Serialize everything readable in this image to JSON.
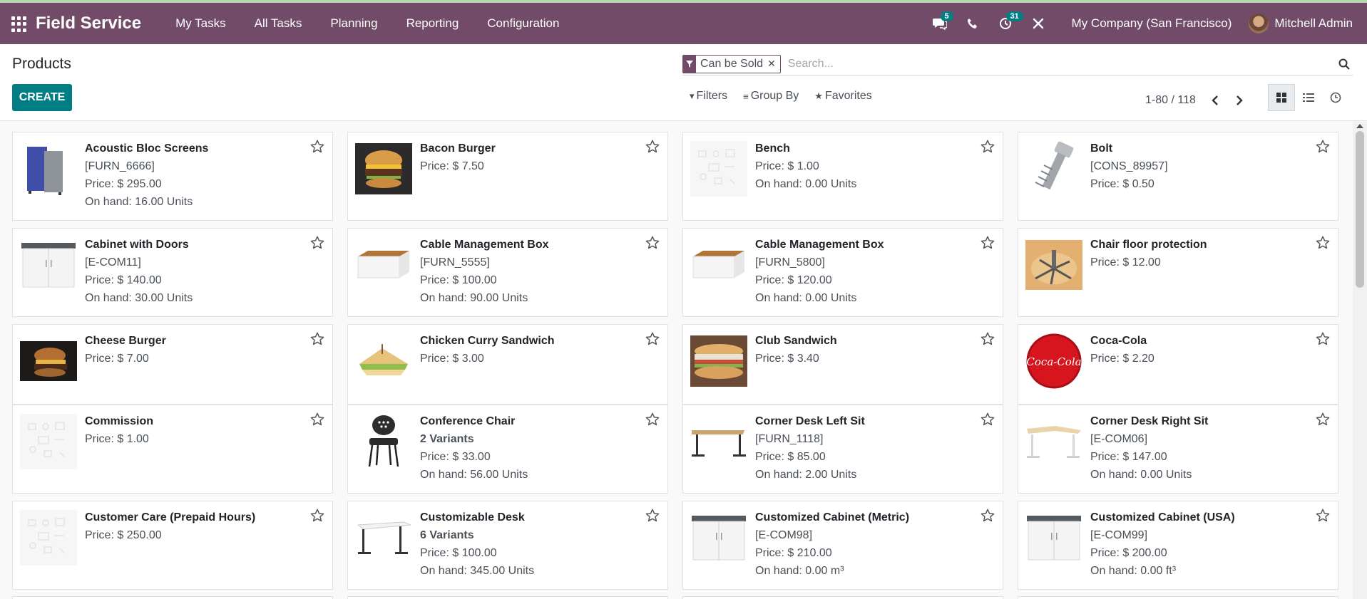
{
  "app": {
    "name": "Field Service"
  },
  "nav": {
    "items": [
      "My Tasks",
      "All Tasks",
      "Planning",
      "Reporting",
      "Configuration"
    ]
  },
  "systray": {
    "messages_count": "5",
    "activities_count": "31",
    "company": "My Company (San Francisco)",
    "user": "Mitchell Admin"
  },
  "page": {
    "title": "Products",
    "create_label": "CREATE"
  },
  "search": {
    "facet": "Can be Sold",
    "placeholder": "Search...",
    "filters_label": "Filters",
    "groupby_label": "Group By",
    "favorites_label": "Favorites"
  },
  "pager": {
    "value": "1-80 / 118"
  },
  "colors": {
    "brand": "#714b67",
    "accent": "#017e84"
  },
  "cards": [
    {
      "name": "Acoustic Bloc Screens",
      "lines": [
        "[FURN_6666]",
        "Price: $ 295.00",
        "On hand: 16.00 Units"
      ],
      "icon": "acoustic-screen-image"
    },
    {
      "name": "Bacon Burger",
      "lines": [
        "Price: $ 7.50"
      ],
      "icon": "burger-image"
    },
    {
      "name": "Bench",
      "lines": [
        "Price: $ 1.00",
        "On hand: 0.00 Units"
      ],
      "icon": "placeholder-image"
    },
    {
      "name": "Bolt",
      "lines": [
        "[CONS_89957]",
        "Price: $ 0.50"
      ],
      "icon": "bolt-image"
    },
    {
      "name": "Cabinet with Doors",
      "lines": [
        "[E-COM11]",
        "Price: $ 140.00",
        "On hand: 30.00 Units"
      ],
      "icon": "cabinet-image"
    },
    {
      "name": "Cable Management Box",
      "lines": [
        "[FURN_5555]",
        "Price: $ 100.00",
        "On hand: 90.00 Units"
      ],
      "icon": "box-image"
    },
    {
      "name": "Cable Management Box",
      "lines": [
        "[FURN_5800]",
        "Price: $ 120.00",
        "On hand: 0.00 Units"
      ],
      "icon": "box-image"
    },
    {
      "name": "Chair floor protection",
      "lines": [
        "Price: $ 12.00"
      ],
      "icon": "floor-mat-image"
    },
    {
      "name": "Cheese Burger",
      "lines": [
        "Price: $ 7.00"
      ],
      "icon": "burger-dark-image"
    },
    {
      "name": "Chicken Curry Sandwich",
      "lines": [
        "Price: $ 3.00"
      ],
      "icon": "sandwich-image"
    },
    {
      "name": "Club Sandwich",
      "lines": [
        "Price: $ 3.40"
      ],
      "icon": "club-sandwich-image"
    },
    {
      "name": "Coca-Cola",
      "lines": [
        "Price: $ 2.20"
      ],
      "icon": "coca-cola-image"
    },
    {
      "name": "Commission",
      "lines": [
        "Price: $ 1.00"
      ],
      "icon": "placeholder-image"
    },
    {
      "name": "Conference Chair",
      "lines": [
        "2 Variants",
        "Price: $ 33.00",
        "On hand: 56.00 Units"
      ],
      "icon": "chair-image"
    },
    {
      "name": "Corner Desk Left Sit",
      "lines": [
        "[FURN_1118]",
        "Price: $ 85.00",
        "On hand: 2.00 Units"
      ],
      "icon": "desk-image"
    },
    {
      "name": "Corner Desk Right Sit",
      "lines": [
        "[E-COM06]",
        "Price: $ 147.00",
        "On hand: 0.00 Units"
      ],
      "icon": "desk-light-image"
    },
    {
      "name": "Customer Care (Prepaid Hours)",
      "lines": [
        "Price: $ 250.00"
      ],
      "icon": "placeholder-image"
    },
    {
      "name": "Customizable Desk",
      "lines": [
        "6 Variants",
        "Price: $ 100.00",
        "On hand: 345.00 Units"
      ],
      "icon": "desk-white-image"
    },
    {
      "name": "Customized Cabinet (Metric)",
      "lines": [
        "[E-COM98]",
        "Price: $ 210.00",
        "On hand: 0.00 m³"
      ],
      "icon": "cabinet-image"
    },
    {
      "name": "Customized Cabinet (USA)",
      "lines": [
        "[E-COM99]",
        "Price: $ 200.00",
        "On hand: 0.00 ft³"
      ],
      "icon": "cabinet-image"
    }
  ]
}
